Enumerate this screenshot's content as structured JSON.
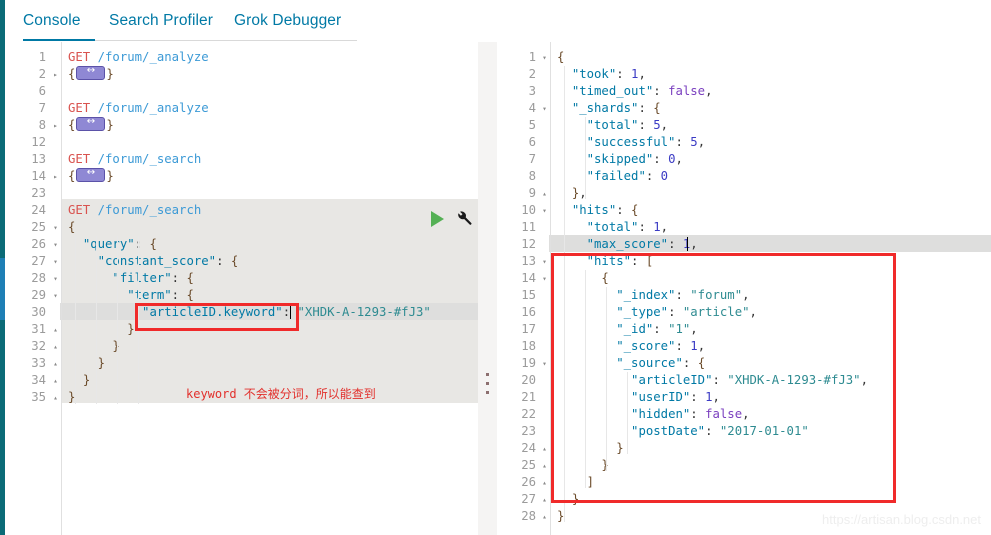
{
  "tabs": [
    {
      "id": "console",
      "label": "Console",
      "active": true
    },
    {
      "id": "profiler",
      "label": "Search Profiler",
      "active": false
    },
    {
      "id": "grok",
      "label": "Grok Debugger",
      "active": false
    }
  ],
  "colors": {
    "accent": "#0079a5",
    "rail": "#0b6b77",
    "annotation_red": "#f02a2a",
    "note_red": "#e2302c",
    "run_green": "#54b054",
    "method_red": "#d9534f",
    "url_blue": "#3c9ad6",
    "key_blue": "#0079a5",
    "string_teal": "#2e8b91",
    "number_blue": "#3b3bc4",
    "bool_purple": "#7a3fbf",
    "selection_gray": "#e8e7e4",
    "active_line_gray": "#dededd"
  },
  "request_editor": {
    "name": "request-editor",
    "lines": [
      {
        "num": "1",
        "fold": "",
        "text": "GET /forum/_analyze",
        "type": "request"
      },
      {
        "num": "2",
        "fold": "right",
        "text": "{ … }",
        "type": "folded"
      },
      {
        "num": "6",
        "fold": "",
        "text": "",
        "type": "blank"
      },
      {
        "num": "7",
        "fold": "",
        "text": "GET /forum/_analyze",
        "type": "request"
      },
      {
        "num": "8",
        "fold": "right",
        "text": "{ … }",
        "type": "folded"
      },
      {
        "num": "12",
        "fold": "",
        "text": "",
        "type": "blank"
      },
      {
        "num": "13",
        "fold": "",
        "text": "GET /forum/_search",
        "type": "request"
      },
      {
        "num": "14",
        "fold": "right",
        "text": "{ … }",
        "type": "folded"
      },
      {
        "num": "23",
        "fold": "",
        "text": "",
        "type": "blank"
      },
      {
        "num": "24",
        "fold": "",
        "text": "GET /forum/_search",
        "type": "request"
      },
      {
        "num": "25",
        "fold": "down",
        "text": "{",
        "type": "json"
      },
      {
        "num": "26",
        "fold": "down",
        "text": "  \"query\": {",
        "type": "json"
      },
      {
        "num": "27",
        "fold": "down",
        "text": "    \"constant_score\": {",
        "type": "json"
      },
      {
        "num": "28",
        "fold": "down",
        "text": "      \"filter\": {",
        "type": "json"
      },
      {
        "num": "29",
        "fold": "down",
        "text": "        \"term\": {",
        "type": "json"
      },
      {
        "num": "30",
        "fold": "",
        "text": "          \"articleID.keyword\": \"XHDK-A-1293-#fJ3\"",
        "type": "json"
      },
      {
        "num": "31",
        "fold": "up",
        "text": "        }",
        "type": "json"
      },
      {
        "num": "32",
        "fold": "up",
        "text": "      }",
        "type": "json"
      },
      {
        "num": "33",
        "fold": "up",
        "text": "    }",
        "type": "json"
      },
      {
        "num": "34",
        "fold": "up",
        "text": "  }",
        "type": "json"
      },
      {
        "num": "35",
        "fold": "up",
        "text": "}",
        "type": "json"
      }
    ],
    "method": "GET",
    "paths": {
      "analyze": "/forum/_analyze",
      "search": "/forum/_search"
    },
    "query_key": "\"articleID.keyword\"",
    "query_value": "\"XHDK-A-1293-#fJ3\"",
    "active_line": "30",
    "run_icon": "play-icon",
    "settings_icon": "wrench-icon"
  },
  "response_editor": {
    "name": "response-viewer",
    "active_line": "12",
    "lines": [
      {
        "num": "1",
        "fold": "down",
        "text": "{"
      },
      {
        "num": "2",
        "fold": "",
        "text": "  \"took\": 1,"
      },
      {
        "num": "3",
        "fold": "",
        "text": "  \"timed_out\": false,"
      },
      {
        "num": "4",
        "fold": "down",
        "text": "  \"_shards\": {"
      },
      {
        "num": "5",
        "fold": "",
        "text": "    \"total\": 5,"
      },
      {
        "num": "6",
        "fold": "",
        "text": "    \"successful\": 5,"
      },
      {
        "num": "7",
        "fold": "",
        "text": "    \"skipped\": 0,"
      },
      {
        "num": "8",
        "fold": "",
        "text": "    \"failed\": 0"
      },
      {
        "num": "9",
        "fold": "up",
        "text": "  },"
      },
      {
        "num": "10",
        "fold": "down",
        "text": "  \"hits\": {"
      },
      {
        "num": "11",
        "fold": "",
        "text": "    \"total\": 1,"
      },
      {
        "num": "12",
        "fold": "",
        "text": "    \"max_score\": 1,"
      },
      {
        "num": "13",
        "fold": "down",
        "text": "    \"hits\": ["
      },
      {
        "num": "14",
        "fold": "down",
        "text": "      {"
      },
      {
        "num": "15",
        "fold": "",
        "text": "        \"_index\": \"forum\","
      },
      {
        "num": "16",
        "fold": "",
        "text": "        \"_type\": \"article\","
      },
      {
        "num": "17",
        "fold": "",
        "text": "        \"_id\": \"1\","
      },
      {
        "num": "18",
        "fold": "",
        "text": "        \"_score\": 1,"
      },
      {
        "num": "19",
        "fold": "down",
        "text": "        \"_source\": {"
      },
      {
        "num": "20",
        "fold": "",
        "text": "          \"articleID\": \"XHDK-A-1293-#fJ3\","
      },
      {
        "num": "21",
        "fold": "",
        "text": "          \"userID\": 1,"
      },
      {
        "num": "22",
        "fold": "",
        "text": "          \"hidden\": false,"
      },
      {
        "num": "23",
        "fold": "",
        "text": "          \"postDate\": \"2017-01-01\""
      },
      {
        "num": "24",
        "fold": "up",
        "text": "        }"
      },
      {
        "num": "25",
        "fold": "up",
        "text": "      }"
      },
      {
        "num": "26",
        "fold": "up",
        "text": "    ]"
      },
      {
        "num": "27",
        "fold": "up",
        "text": "  }"
      },
      {
        "num": "28",
        "fold": "up",
        "text": "}"
      }
    ],
    "values": {
      "took": 1,
      "timed_out": false,
      "shards": {
        "total": 5,
        "successful": 5,
        "skipped": 0,
        "failed": 0
      },
      "hits_total": 1,
      "max_score": 1,
      "hit": {
        "_index": "forum",
        "_type": "article",
        "_id": "1",
        "_score": 1,
        "_source": {
          "articleID": "XHDK-A-1293-#fJ3",
          "userID": 1,
          "hidden": false,
          "postDate": "2017-01-01"
        }
      }
    }
  },
  "annotations": {
    "note_text": "keyword 不会被分词，所以能查到",
    "left_box_name": "highlight-box-query-key",
    "right_box_name": "highlight-box-hits"
  },
  "watermark": "https://artisan.blog.csdn.net"
}
